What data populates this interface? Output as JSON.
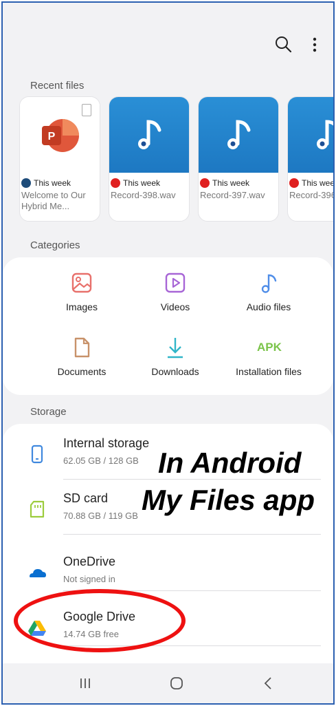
{
  "topbar": {
    "search_icon": "search-icon",
    "more_icon": "more-vert-icon"
  },
  "recent": {
    "title": "Recent files",
    "items": [
      {
        "when": "This week",
        "name": "Welcome to Our Hybrid Me...",
        "source_color": "#1e4c7a",
        "type": "powerpoint"
      },
      {
        "when": "This week",
        "name": "Record-398.wav",
        "source_color": "#e02020",
        "type": "audio"
      },
      {
        "when": "This week",
        "name": "Record-397.wav",
        "source_color": "#e02020",
        "type": "audio"
      },
      {
        "when": "This wee",
        "name": "Record-396",
        "source_color": "#e02020",
        "type": "audio"
      }
    ]
  },
  "categories": {
    "title": "Categories",
    "items": [
      {
        "label": "Images",
        "icon": "image-icon",
        "color": "#e8706b"
      },
      {
        "label": "Videos",
        "icon": "video-icon",
        "color": "#a765d6"
      },
      {
        "label": "Audio files",
        "icon": "music-note-icon",
        "color": "#4f8de8"
      },
      {
        "label": "Documents",
        "icon": "document-icon",
        "color": "#c8926a"
      },
      {
        "label": "Downloads",
        "icon": "download-icon",
        "color": "#2fb5c8"
      },
      {
        "label": "Installation files",
        "icon": "apk-icon",
        "icon_text": "APK",
        "color": "#7bc44a"
      }
    ]
  },
  "storage": {
    "title": "Storage",
    "items": [
      {
        "name": "Internal storage",
        "sub": "62.05 GB / 128 GB",
        "icon": "phone-icon",
        "color": "#3f88de"
      },
      {
        "name": "SD card",
        "sub": "70.88 GB / 119 GB",
        "icon": "sd-card-icon",
        "color": "#9ccc3c"
      },
      {
        "name": "OneDrive",
        "sub": "Not signed in",
        "icon": "onedrive-icon",
        "color": "#0a6fd0"
      },
      {
        "name": "Google Drive",
        "sub": "14.74 GB free",
        "icon": "google-drive-icon",
        "color": "#1fa463"
      }
    ]
  },
  "overlay": {
    "line1": "In Android",
    "line2": "My Files app"
  },
  "navbar": {
    "recents_icon": "recents-icon",
    "home_icon": "home-icon",
    "back_icon": "back-icon"
  }
}
